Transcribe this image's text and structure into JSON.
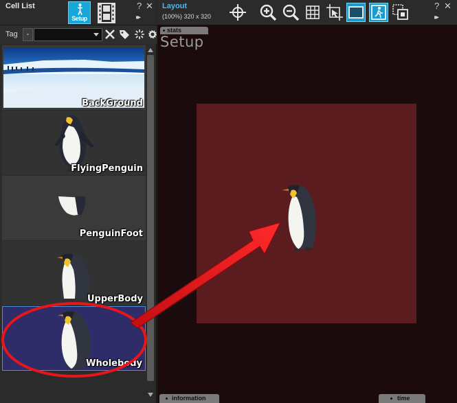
{
  "left_panel": {
    "title": "Cell List",
    "setup_button_label": "Setup",
    "help_label": "?",
    "close_label": "✕",
    "forward_label": "▸▸",
    "tag": {
      "label": "Tag",
      "minus_label": "-",
      "selected_value": ""
    },
    "cells": [
      {
        "label": "BackGround",
        "selected": false
      },
      {
        "label": "FlyingPenguin",
        "selected": false
      },
      {
        "label": "PenguinFoot",
        "selected": false
      },
      {
        "label": "UpperBody",
        "selected": false
      },
      {
        "label": "Wholebody",
        "selected": true
      }
    ]
  },
  "right_panel": {
    "title": "Layout",
    "subtitle": "(100%) 320 x 320",
    "help_label": "?",
    "close_label": "✕",
    "forward_label": "▸▸",
    "tools": [
      "crosshair-icon",
      "zoom-in-icon",
      "zoom-out-icon",
      "grid-icon",
      "crop-pointer-icon",
      "frame-icon",
      "person-icon",
      "layer-icon"
    ],
    "stats_tab": "stats",
    "watermark": "Setup",
    "information_tab": "information",
    "time_tab": "time"
  },
  "colors": {
    "accent": "#1a9bd0",
    "stage": "#5a1c1e",
    "canvas_bg": "#1c0b0c",
    "selection_bg": "#2e2d6a",
    "annotation_red": "#e8151a"
  }
}
